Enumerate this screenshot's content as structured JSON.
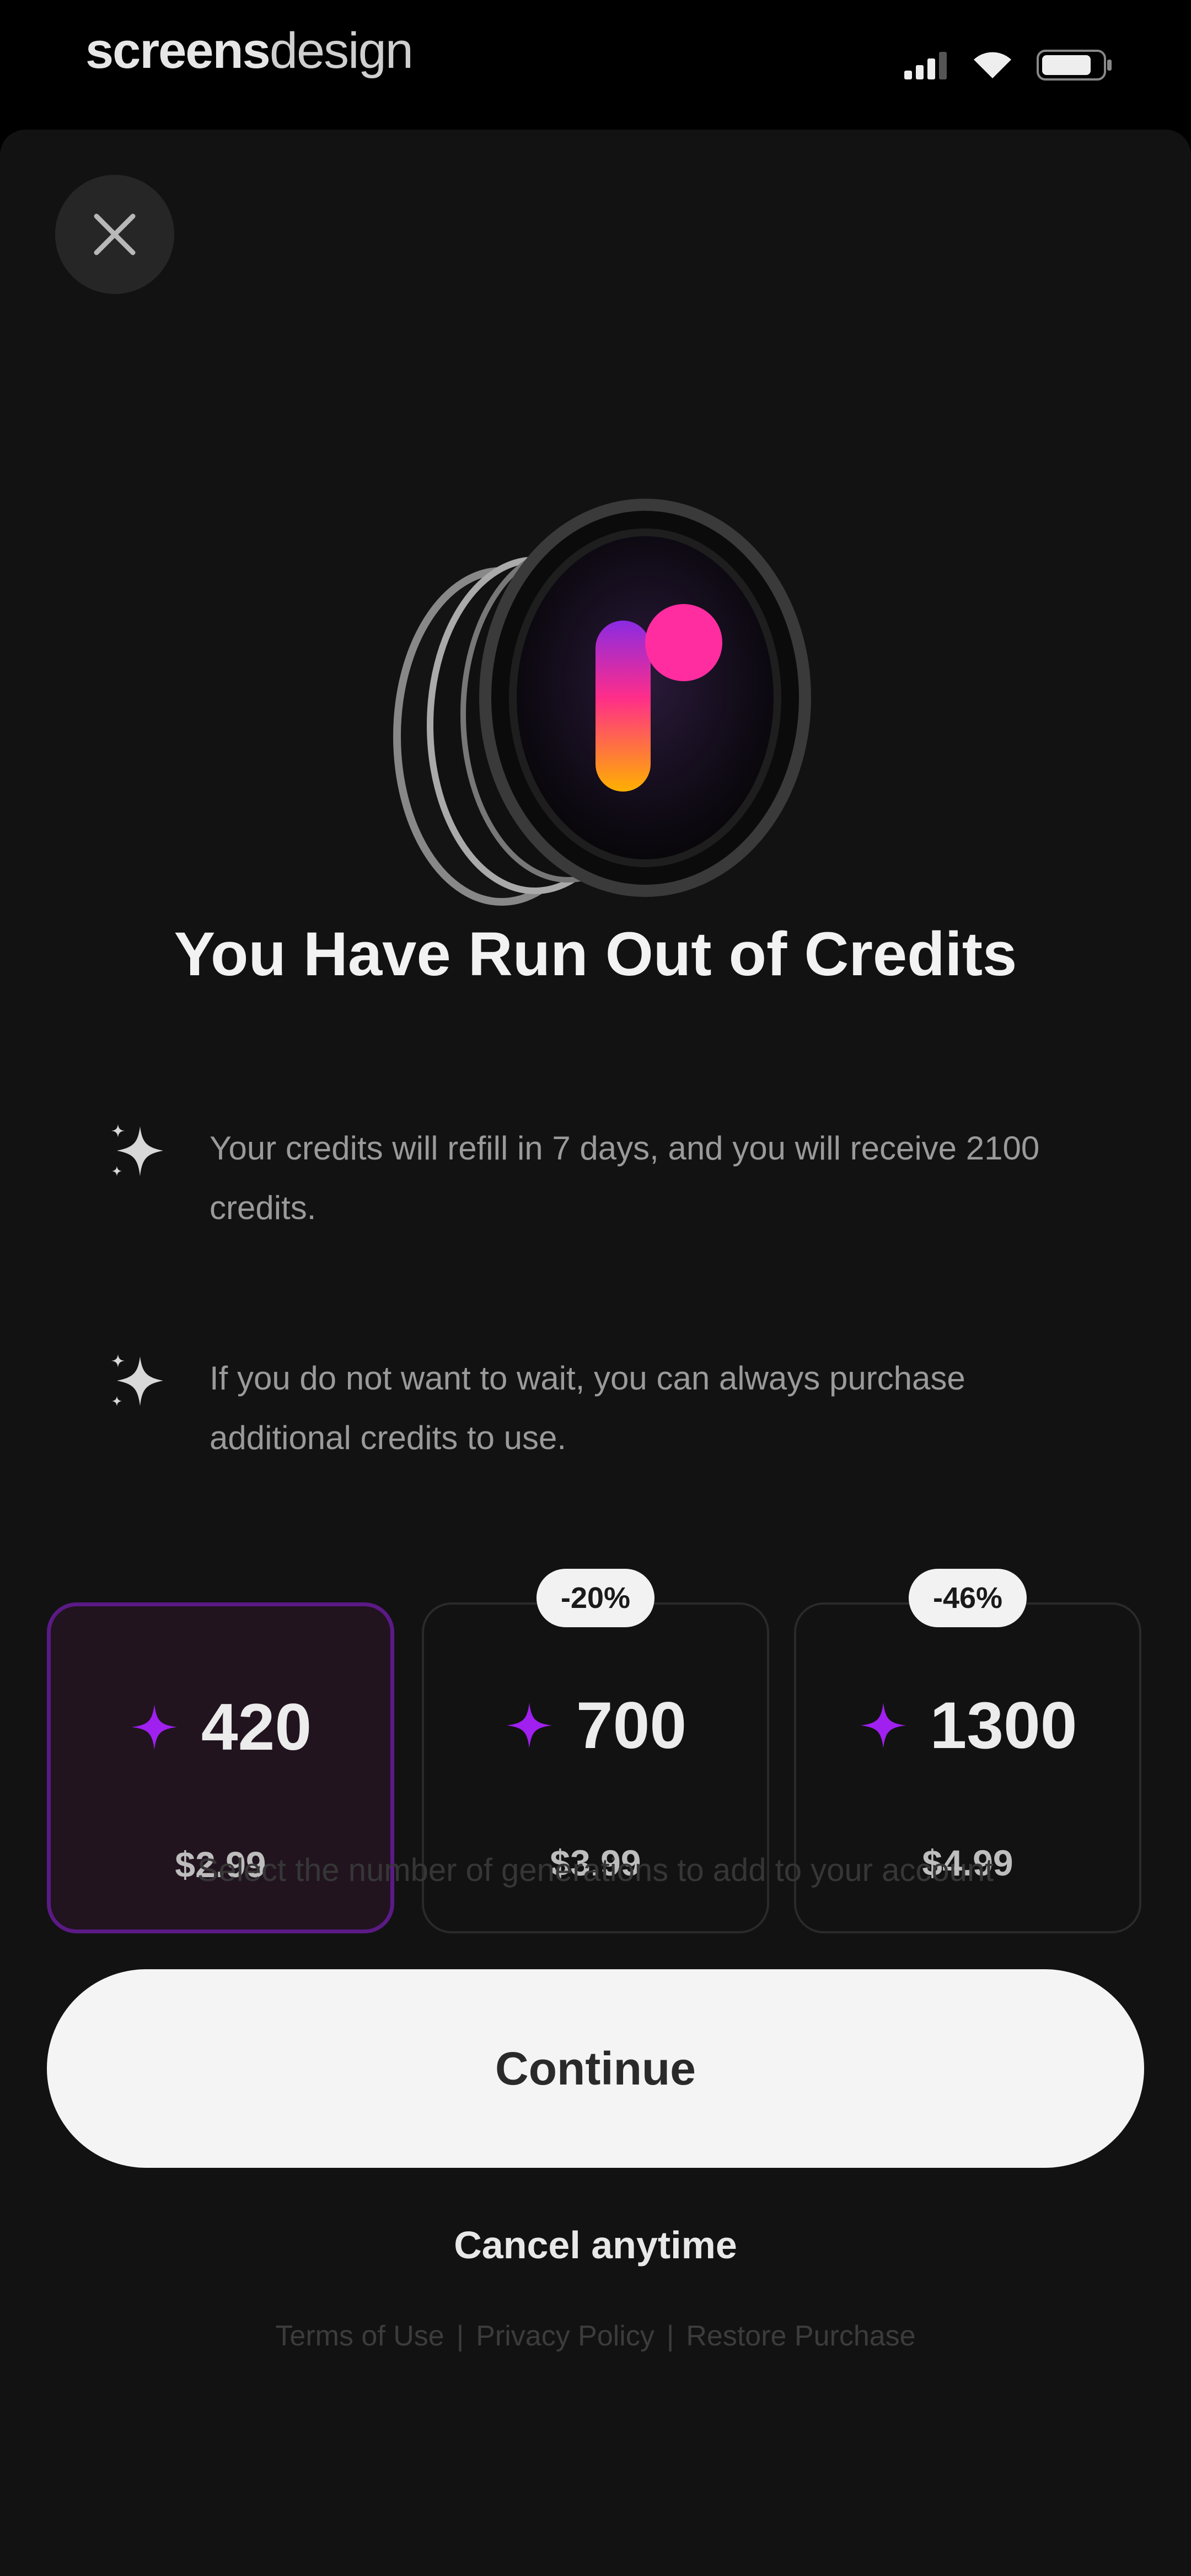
{
  "watermark": {
    "part1": "screens",
    "part2": "design"
  },
  "status_icons": [
    "signal-icon",
    "wifi-icon",
    "battery-icon"
  ],
  "close_icon": "close-icon",
  "title": "You Have Run Out of Credits",
  "info": [
    {
      "icon": "sparkle-icon",
      "text": "Your credits will refill in 7 days, and you will receive 2100 credits."
    },
    {
      "icon": "sparkle-icon",
      "text": "If you do not want to wait, you can always purchase additional credits to use."
    }
  ],
  "plans": [
    {
      "credits": "420",
      "price": "$2.99",
      "badge": "",
      "selected": true
    },
    {
      "credits": "700",
      "price": "$3.99",
      "badge": "-20%",
      "selected": false
    },
    {
      "credits": "1300",
      "price": "$4.99",
      "badge": "-46%",
      "selected": false
    }
  ],
  "hint": "Select the number of generations to add to your account",
  "continue_label": "Continue",
  "cancel_label": "Cancel anytime",
  "footer": {
    "terms": "Terms of Use",
    "sep1": "|",
    "privacy": "Privacy Policy",
    "sep2": "|",
    "restore": "Restore Purchase"
  },
  "colors": {
    "accent": "#a020f0",
    "selected_border": "#5b1a86",
    "background": "#121212",
    "button": "#f4f4f4"
  }
}
